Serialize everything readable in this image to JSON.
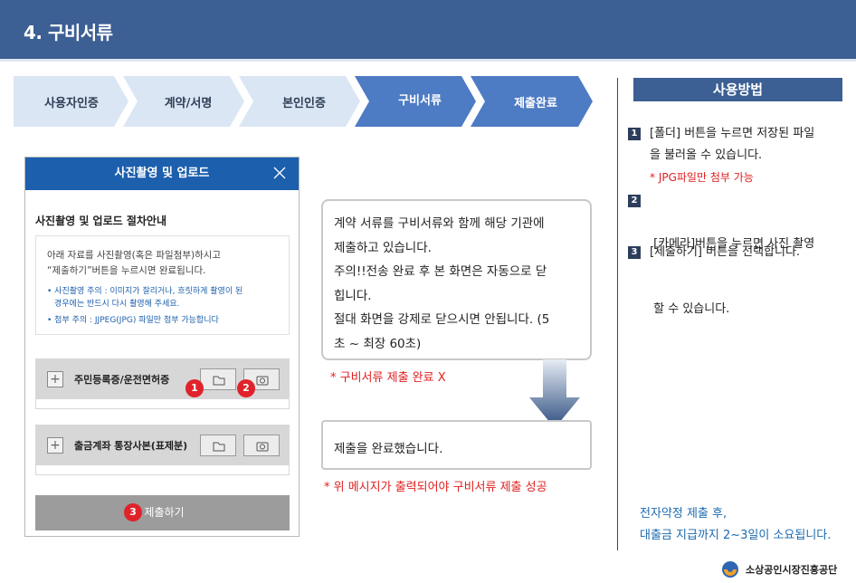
{
  "header": {
    "title": "4. 구비서류"
  },
  "steps": [
    {
      "label": "사용자인증",
      "active": false
    },
    {
      "label": "계약/서명",
      "active": false
    },
    {
      "label": "본인인증",
      "active": false
    },
    {
      "label": "구비서류",
      "active": true
    },
    {
      "label": "제출완료",
      "active": true
    }
  ],
  "colors": {
    "header": "#3c5f94",
    "step_inactive": "#dbe6f4",
    "step_active": "#4d7bc4",
    "accent_red": "#e02020",
    "modal_head": "#1c5fad"
  },
  "modal": {
    "title": "사진촬영 및 업로드",
    "close_icon": "close-icon",
    "guide_title": "사진촬영 및 업로드 절차안내",
    "guide_line1": "아래 자료를 사진촬영(혹은 파일첨부)하시고",
    "guide_line2": "“제출하기”버튼을 누르시면 완료됩니다.",
    "bullet1_line1": "• 사진촬영 주의 : 이미지가 잘리거나, 흐릿하게 촬영이 된",
    "bullet1_line2": "경우에는 반드시 다시 촬영해 주세요.",
    "bullet2": "• 첨부 주의 : JJPEG(JPG) 파일만 첨부 가능합니다",
    "uploads": [
      {
        "label": "주민등록증/운전면허증",
        "folder_icon": "folder-icon",
        "camera_icon": "camera-icon"
      },
      {
        "label": "출금계좌 통장사본(표제분)",
        "folder_icon": "folder-icon",
        "camera_icon": "camera-icon"
      }
    ],
    "markers": [
      "1",
      "2",
      "3"
    ],
    "submit_label": "제출하기"
  },
  "message1": {
    "lines": [
      "계약 서류를 구비서류와 함께 해당 기관에",
      "제출하고 있습니다.",
      "주의!!전송 완료 후 본 화면은 자동으로 닫",
      "힙니다.",
      "절대 화면을 강제로 닫으시면 안됩니다. (5",
      "초 ~ 최장 60초)"
    ]
  },
  "note_fail": "* 구비서류 제출 완료 X",
  "message2": {
    "text": "제출을 완료했습니다."
  },
  "note_success": "* 위 메시지가 출력되어야 구비서류 제출 성공",
  "usage": {
    "title": "사용방법",
    "items": [
      {
        "num": "1",
        "line1": "[폴더] 버튼을 누르면 저장된 파일",
        "line2": "을 불러올 수 있습니다.",
        "note": "* JPG파일만 첨부 가능"
      },
      {
        "num": "2",
        "line1": " [카메라]버튼을 누르면 사진 촬영",
        "line2": " 할 수 있습니다."
      },
      {
        "num": "3",
        "line1": "[제출하기] 버튼을 선택합니다."
      }
    ],
    "bottom_line1": "전자약정 제출 후,",
    "bottom_line2": "대출금 지급까지 2~3일이 소요됩니다."
  },
  "logo": {
    "text": "소상공인시장진흥공단"
  }
}
